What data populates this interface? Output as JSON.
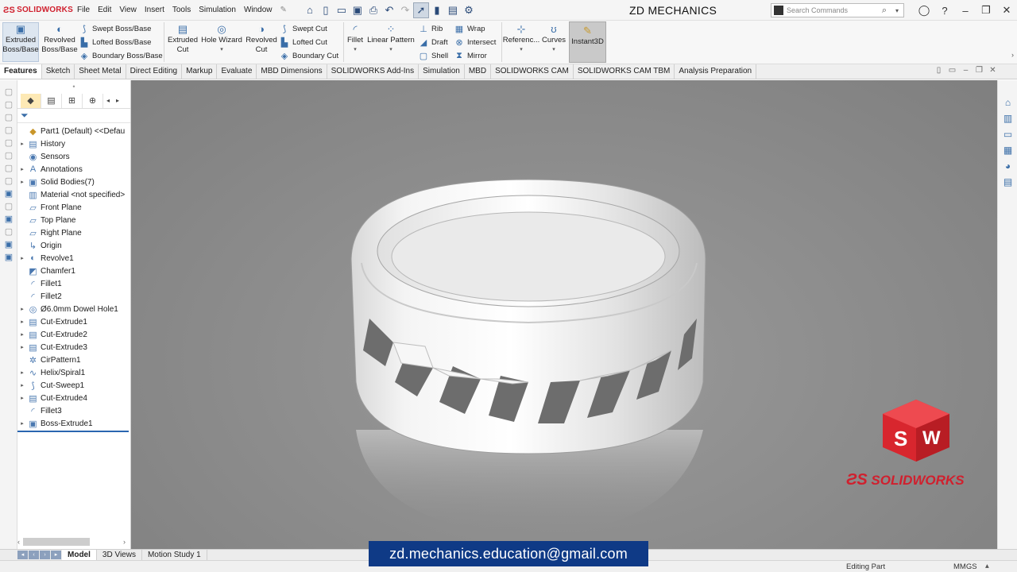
{
  "app": {
    "logo_text": "SOLIDWORKS",
    "title": "ZD MECHANICS",
    "search_placeholder": "Search Commands"
  },
  "menu": [
    "File",
    "Edit",
    "View",
    "Insert",
    "Tools",
    "Simulation",
    "Window"
  ],
  "ribbon": {
    "extruded_boss": "Extruded Boss/Base",
    "revolved_boss": "Revolved Boss/Base",
    "swept_boss": "Swept Boss/Base",
    "lofted_boss": "Lofted Boss/Base",
    "boundary_boss": "Boundary Boss/Base",
    "extruded_cut": "Extruded Cut",
    "hole_wizard": "Hole Wizard",
    "revolved_cut": "Revolved Cut",
    "swept_cut": "Swept Cut",
    "lofted_cut": "Lofted Cut",
    "boundary_cut": "Boundary Cut",
    "fillet": "Fillet",
    "linear_pattern": "Linear Pattern",
    "rib": "Rib",
    "draft": "Draft",
    "shell": "Shell",
    "wrap": "Wrap",
    "intersect": "Intersect",
    "mirror": "Mirror",
    "reference": "Referenc...",
    "curves": "Curves",
    "instant3d": "Instant3D"
  },
  "tabs": [
    "Features",
    "Sketch",
    "Sheet Metal",
    "Direct Editing",
    "Markup",
    "Evaluate",
    "MBD Dimensions",
    "SOLIDWORKS Add-Ins",
    "Simulation",
    "MBD",
    "SOLIDWORKS CAM",
    "SOLIDWORKS CAM TBM",
    "Analysis Preparation"
  ],
  "tree": [
    {
      "label": "Part1  (Default) <<Defau",
      "expandable": false,
      "icon": "part-icon"
    },
    {
      "label": "History",
      "expandable": true,
      "icon": "history-icon"
    },
    {
      "label": "Sensors",
      "expandable": false,
      "icon": "sensor-icon"
    },
    {
      "label": "Annotations",
      "expandable": true,
      "icon": "annotation-icon"
    },
    {
      "label": "Solid Bodies(7)",
      "expandable": true,
      "icon": "solid-bodies-icon"
    },
    {
      "label": "Material <not specified>",
      "expandable": false,
      "icon": "material-icon"
    },
    {
      "label": "Front Plane",
      "expandable": false,
      "icon": "plane-icon"
    },
    {
      "label": "Top Plane",
      "expandable": false,
      "icon": "plane-icon"
    },
    {
      "label": "Right Plane",
      "expandable": false,
      "icon": "plane-icon"
    },
    {
      "label": "Origin",
      "expandable": false,
      "icon": "origin-icon"
    },
    {
      "label": "Revolve1",
      "expandable": true,
      "icon": "revolve-icon"
    },
    {
      "label": "Chamfer1",
      "expandable": false,
      "icon": "chamfer-icon"
    },
    {
      "label": "Fillet1",
      "expandable": false,
      "icon": "fillet-icon"
    },
    {
      "label": "Fillet2",
      "expandable": false,
      "icon": "fillet-icon"
    },
    {
      "label": "Ø6.0mm Dowel Hole1",
      "expandable": true,
      "icon": "hole-icon"
    },
    {
      "label": "Cut-Extrude1",
      "expandable": true,
      "icon": "cut-extrude-icon"
    },
    {
      "label": "Cut-Extrude2",
      "expandable": true,
      "icon": "cut-extrude-icon"
    },
    {
      "label": "Cut-Extrude3",
      "expandable": true,
      "icon": "cut-extrude-icon"
    },
    {
      "label": "CirPattern1",
      "expandable": false,
      "icon": "circular-pattern-icon"
    },
    {
      "label": "Helix/Spiral1",
      "expandable": true,
      "icon": "helix-icon"
    },
    {
      "label": "Cut-Sweep1",
      "expandable": true,
      "icon": "cut-sweep-icon"
    },
    {
      "label": "Cut-Extrude4",
      "expandable": true,
      "icon": "cut-extrude-icon"
    },
    {
      "label": "Fillet3",
      "expandable": false,
      "icon": "fillet-icon"
    },
    {
      "label": "Boss-Extrude1",
      "expandable": true,
      "icon": "boss-extrude-icon"
    }
  ],
  "bottom_tabs": [
    "Model",
    "3D Views",
    "Motion Study 1"
  ],
  "status": {
    "mode": "Editing Part",
    "units": "MMGS"
  },
  "watermark_text": "SOLIDWORKS",
  "email": "zd.mechanics.education@gmail.com"
}
